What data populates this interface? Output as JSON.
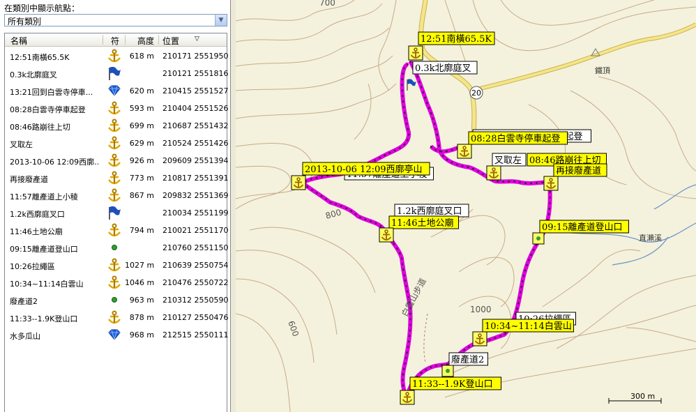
{
  "category_label": "在類別中顯示航點：",
  "category_value": "所有類別",
  "columns": {
    "name": "名稱",
    "symbol": "符",
    "altitude": "高度",
    "position": "位置",
    "sort": "▽"
  },
  "waypoints": [
    {
      "name": "12:51南橫65.5K",
      "icon": "anchor-icon",
      "alt": "618 m",
      "pos": "210171 2551950"
    },
    {
      "name": "0.3k北廓庭叉",
      "icon": "flag-icon",
      "alt": "",
      "pos": "210121 2551816"
    },
    {
      "name": "13:21回到白雲寺停車...",
      "icon": "diamond-icon",
      "alt": "620 m",
      "pos": "210415 2551527"
    },
    {
      "name": "08:28白雲寺停車起登",
      "icon": "anchor-icon",
      "alt": "593 m",
      "pos": "210404 2551526"
    },
    {
      "name": "08:46路崩往上切",
      "icon": "anchor-icon",
      "alt": "699 m",
      "pos": "210687 2551432"
    },
    {
      "name": "叉取左",
      "icon": "anchor-icon",
      "alt": "629 m",
      "pos": "210524 2551426"
    },
    {
      "name": "2013-10-06 12:09西廓...",
      "icon": "anchor-icon",
      "alt": "926 m",
      "pos": "209609 2551394"
    },
    {
      "name": "再接廢產道",
      "icon": "anchor-icon",
      "alt": "773 m",
      "pos": "210817 2551391"
    },
    {
      "name": "11:57離產道上小稜",
      "icon": "anchor-icon",
      "alt": "867 m",
      "pos": "209832 2551369"
    },
    {
      "name": "1.2k西廓庭叉口",
      "icon": "flag-icon",
      "alt": "",
      "pos": "210034 2551199"
    },
    {
      "name": "11:46土地公廟",
      "icon": "anchor-icon",
      "alt": "794 m",
      "pos": "210021 2551170"
    },
    {
      "name": "09:15離產道登山口",
      "icon": "dot-icon",
      "alt": "",
      "pos": "210760 2551150"
    },
    {
      "name": "10:26拉繩區",
      "icon": "anchor-icon",
      "alt": "1027 m",
      "pos": "210639 2550754"
    },
    {
      "name": "10:34~11:14白雲山",
      "icon": "anchor-icon",
      "alt": "1046 m",
      "pos": "210476 2550722"
    },
    {
      "name": "廢產道2",
      "icon": "dot-icon",
      "alt": "963 m",
      "pos": "210312 2550590"
    },
    {
      "name": "11:33--1.9K登山口",
      "icon": "anchor-icon",
      "alt": "878 m",
      "pos": "210127 2550476"
    },
    {
      "name": "水多瓜山",
      "icon": "diamond-icon",
      "alt": "968 m",
      "pos": "212515 2550111"
    }
  ],
  "map": {
    "contours": [
      "700",
      "800",
      "600",
      "1000"
    ],
    "road_number": "20",
    "peak_label": "鐵頂",
    "trail_label": "白雲山步道",
    "stream_label": "直瀨溪",
    "scale": "300 m",
    "labels": {
      "l1": "12:51南橫65.5K",
      "l2": "0.3k北廓庭叉",
      "l3": "08:28白雲寺停車起登",
      "l3b": "13:21回到白雲寺停車起登",
      "l4": "08:46路崩往上切",
      "l5": "叉取左",
      "l6": "2013-10-06 12:09西廓亭山",
      "l6b": "11:57離產道上小稜",
      "l7": "再接廢產道",
      "l8": "1.2k西廓庭叉口",
      "l9": "11:46土地公廟",
      "l10": "09:15離產道登山口",
      "l11": "10:26拉繩區",
      "l12": "10:34~11:14白雲山",
      "l13": "廢產道2",
      "l14": "11:33--1.9K登山口"
    }
  },
  "colors": {
    "track": "#e000e0",
    "label_bg": "#ffff00",
    "contour": "#c9a98a",
    "road": "#e8d060",
    "stream": "#6a8fc8"
  }
}
